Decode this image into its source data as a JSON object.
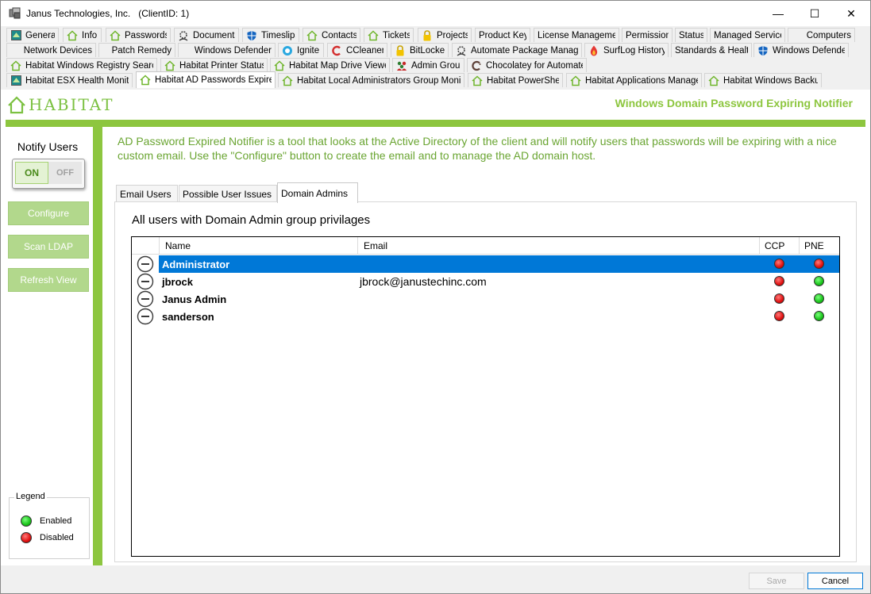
{
  "window": {
    "title": "Janus Technologies, Inc.   (ClientID: 1)",
    "minimize_glyph": "—",
    "maximize_glyph": "☐",
    "close_glyph": "✕"
  },
  "tabs": {
    "row1": [
      {
        "label": "General",
        "icon": "habitat-square-icon"
      },
      {
        "label": "Info",
        "icon": "house-icon"
      },
      {
        "label": "Passwords",
        "icon": "house-icon"
      },
      {
        "label": "Documents",
        "icon": "gear-person-icon"
      },
      {
        "label": "Timeslips",
        "icon": "shield-icon"
      },
      {
        "label": "Contacts",
        "icon": "house-icon"
      },
      {
        "label": "Tickets",
        "icon": "house-icon"
      },
      {
        "label": "Projects",
        "icon": "lock-icon"
      },
      {
        "label": "Product Keys",
        "icon": ""
      },
      {
        "label": "License Management",
        "icon": ""
      },
      {
        "label": "Permissions",
        "icon": ""
      },
      {
        "label": "Status",
        "icon": ""
      },
      {
        "label": "Managed Services",
        "icon": ""
      },
      {
        "label": "Computers",
        "icon": ""
      }
    ],
    "row2": [
      {
        "label": "Network Devices",
        "icon": ""
      },
      {
        "label": "Patch Remedy",
        "icon": ""
      },
      {
        "label": "Windows Defender",
        "icon": ""
      },
      {
        "label": "Ignite",
        "icon": "ignite-icon"
      },
      {
        "label": "CCleaner",
        "icon": "ccleaner-icon"
      },
      {
        "label": "BitLocker",
        "icon": "lock-icon"
      },
      {
        "label": "Automate Package Manager",
        "icon": "gear-person-icon"
      },
      {
        "label": "SurfLog History",
        "icon": "flame-icon"
      },
      {
        "label": "Standards & Health",
        "icon": ""
      },
      {
        "label": "Windows Defender",
        "icon": "shield-icon"
      }
    ],
    "row3": [
      {
        "label": "Habitat Windows Registry Search",
        "icon": "house-icon"
      },
      {
        "label": "Habitat Printer Status",
        "icon": "house-icon"
      },
      {
        "label": "Habitat Map Drive Viewer",
        "icon": "house-icon"
      },
      {
        "label": "Admin Group",
        "icon": "people-icon"
      },
      {
        "label": "Chocolatey for Automate",
        "icon": "chocolatey-icon"
      }
    ],
    "row4": [
      {
        "label": "Habitat ESX Health Monitor",
        "icon": "habitat-square-icon"
      },
      {
        "label": "Habitat AD Passwords Expired",
        "icon": "house-icon"
      },
      {
        "label": "Habitat Local Administrators Group Monitor",
        "icon": "house-icon"
      },
      {
        "label": "Habitat PowerShell",
        "icon": "house-icon"
      },
      {
        "label": "Habitat Applications Manager",
        "icon": "house-icon"
      },
      {
        "label": "Habitat Windows Backup",
        "icon": "house-icon"
      }
    ]
  },
  "header": {
    "logo_text": "HABITAT",
    "module_title": "Windows Domain Password Expiring Notifier"
  },
  "sidebar": {
    "notify_title": "Notify Users",
    "toggle_on": "ON",
    "toggle_off": "OFF",
    "toggle_state": "on",
    "buttons": [
      "Configure",
      "Scan LDAP",
      "Refresh View"
    ],
    "legend": {
      "title": "Legend",
      "enabled_label": "Enabled",
      "disabled_label": "Disabled"
    }
  },
  "description": "AD Password Expired Notifier is a tool that looks at the Active Directory of the client and will notify users that passwords will be expiring with a nice custom email. Use the \"Configure\" button to create the email and to manage the AD domain host.",
  "inner_tabs": [
    "Email Users",
    "Possible User Issues",
    "Domain Admins"
  ],
  "panel": {
    "heading": "All users with Domain Admin group privilages",
    "columns": [
      "",
      "Name",
      "Email",
      "CCP",
      "PNE"
    ],
    "rows": [
      {
        "name": "Administrator",
        "email": "",
        "ccp": "disabled",
        "pne": "disabled",
        "selected": true
      },
      {
        "name": "jbrock",
        "email": "jbrock@janustechinc.com",
        "ccp": "disabled",
        "pne": "enabled",
        "selected": false
      },
      {
        "name": "Janus Admin",
        "email": "",
        "ccp": "disabled",
        "pne": "enabled",
        "selected": false
      },
      {
        "name": "sanderson",
        "email": "",
        "ccp": "disabled",
        "pne": "enabled",
        "selected": false
      }
    ]
  },
  "footer": {
    "save_label": "Save",
    "cancel_label": "Cancel"
  },
  "colors": {
    "brand_green": "#8dc63f",
    "selection_blue": "#0078d7",
    "enabled": "#19c31a",
    "disabled": "#e01010"
  }
}
